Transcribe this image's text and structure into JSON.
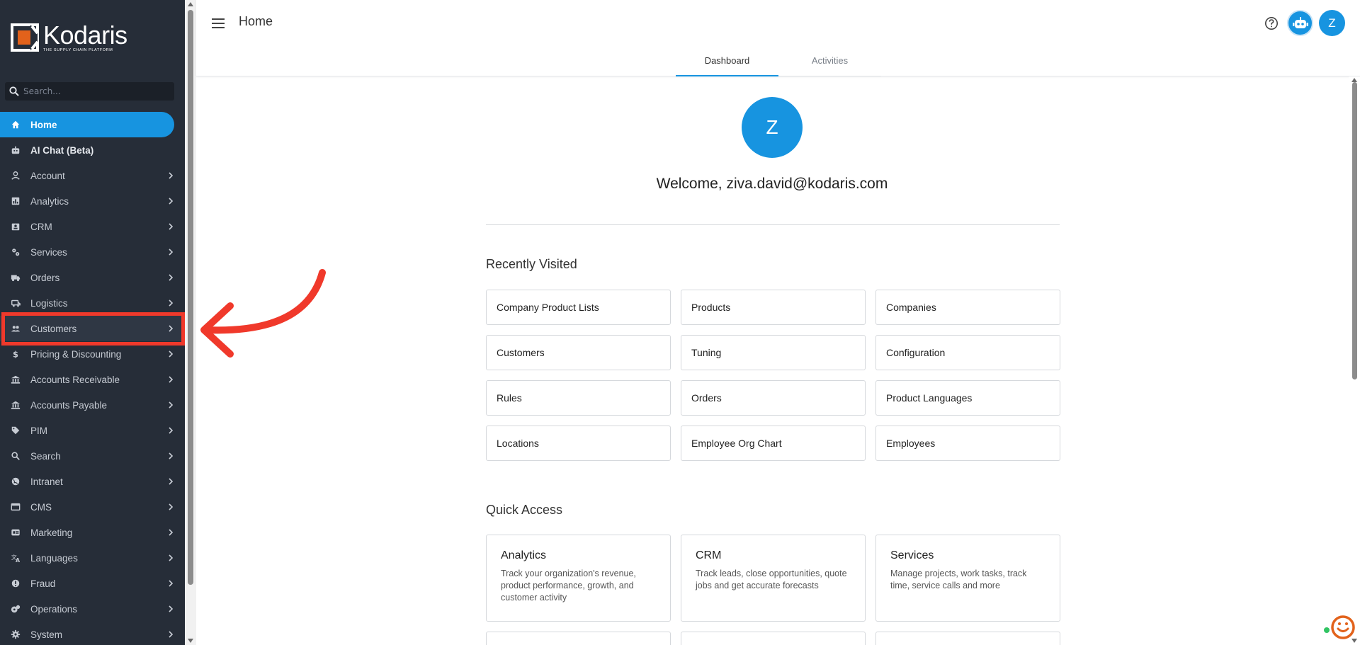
{
  "brand": {
    "name": "Kodaris",
    "tagline": "THE SUPPLY CHAIN PLATFORM"
  },
  "search": {
    "placeholder": "Search..."
  },
  "sidebar": {
    "items": [
      {
        "label": "Home",
        "icon": "home-icon"
      },
      {
        "label": "AI Chat (Beta)",
        "icon": "robot-icon"
      },
      {
        "label": "Account",
        "icon": "person-icon"
      },
      {
        "label": "Analytics",
        "icon": "analytics-icon"
      },
      {
        "label": "CRM",
        "icon": "contact-card-icon"
      },
      {
        "label": "Services",
        "icon": "gears-icon"
      },
      {
        "label": "Orders",
        "icon": "truck-icon"
      },
      {
        "label": "Logistics",
        "icon": "shipping-icon"
      },
      {
        "label": "Customers",
        "icon": "group-icon"
      },
      {
        "label": "Pricing & Discounting",
        "icon": "dollar-icon"
      },
      {
        "label": "Accounts Receivable",
        "icon": "bank-icon"
      },
      {
        "label": "Accounts Payable",
        "icon": "bank-icon"
      },
      {
        "label": "PIM",
        "icon": "tag-icon"
      },
      {
        "label": "Search",
        "icon": "search-icon"
      },
      {
        "label": "Intranet",
        "icon": "globe-icon"
      },
      {
        "label": "CMS",
        "icon": "browser-icon"
      },
      {
        "label": "Marketing",
        "icon": "megaphone-icon"
      },
      {
        "label": "Languages",
        "icon": "translate-icon"
      },
      {
        "label": "Fraud",
        "icon": "alert-icon"
      },
      {
        "label": "Operations",
        "icon": "operations-icon"
      },
      {
        "label": "System",
        "icon": "gear-icon"
      }
    ]
  },
  "header": {
    "title": "Home",
    "avatar_initial": "Z"
  },
  "tabs": [
    {
      "label": "Dashboard"
    },
    {
      "label": "Activities"
    }
  ],
  "main": {
    "avatar_initial": "Z",
    "welcome": "Welcome, ziva.david@kodaris.com",
    "recently_visited_title": "Recently Visited",
    "recently_visited": [
      "Company Product Lists",
      "Products",
      "Companies",
      "Customers",
      "Tuning",
      "Configuration",
      "Rules",
      "Orders",
      "Product Languages",
      "Locations",
      "Employee Org Chart",
      "Employees"
    ],
    "quick_access_title": "Quick Access",
    "quick_access": [
      {
        "title": "Analytics",
        "desc": "Track your organization's revenue, product performance, growth, and customer activity"
      },
      {
        "title": "CRM",
        "desc": "Track leads, close opportunities, quote jobs and get accurate forecasts"
      },
      {
        "title": "Services",
        "desc": "Manage projects, work tasks, track time, service calls and more"
      }
    ]
  },
  "colors": {
    "accent": "#1794e0",
    "sidebar_bg": "#262d38",
    "annotation": "#f0392b",
    "logo_orange": "#e2621b"
  }
}
